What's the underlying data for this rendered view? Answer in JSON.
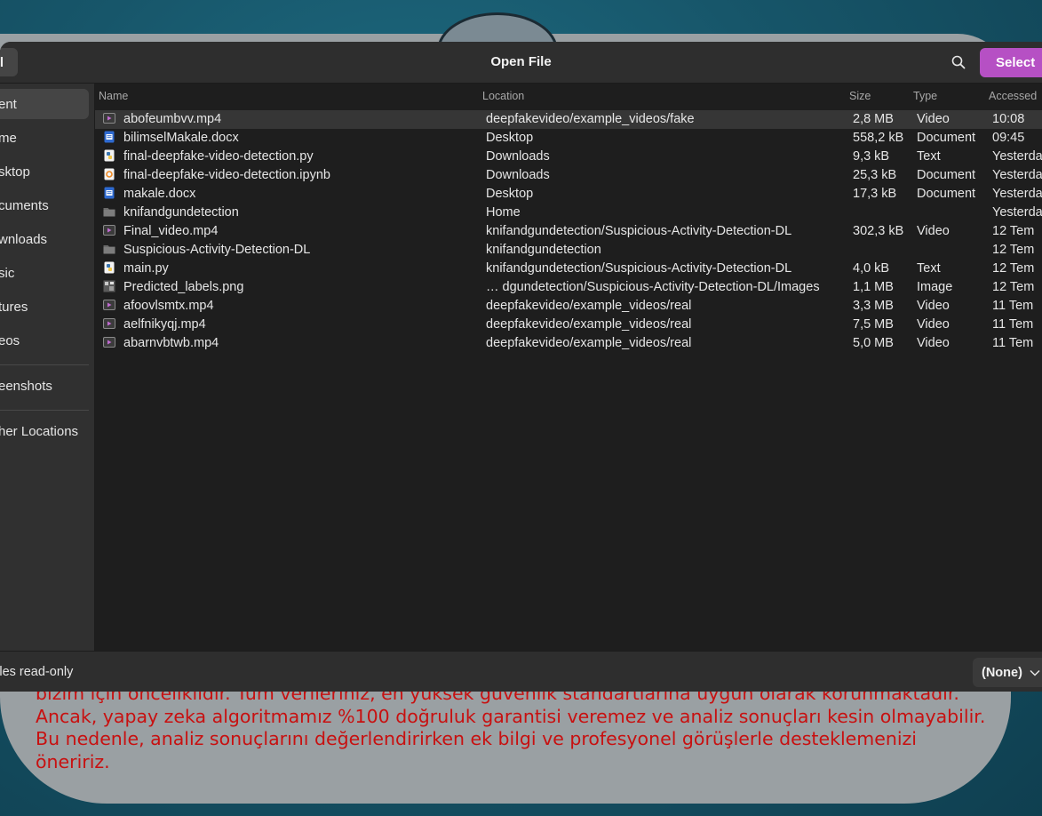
{
  "background_app": {
    "disclaimer_lines": [
      "bizim için önceliklidir. Tüm verileriniz, en yüksek güvenlik standartlarına uygun olarak korunmaktadır.",
      "Ancak, yapay zeka algoritmamız %100 doğruluk garantisi veremez ve analiz sonuçları kesin olmayabilir.",
      "Bu nedenle, analiz sonuçlarını değerlendirirken ek bilgi ve profesyonel görüşlerle desteklemenizi",
      "öneririz."
    ],
    "text_color": "#c81010"
  },
  "dialog": {
    "title": "Open File",
    "cancel_label": "l",
    "select_label": "Select",
    "accent_color": "#b650c4"
  },
  "sidebar": {
    "items": [
      {
        "label": "ent",
        "selected": true
      },
      {
        "label": "me"
      },
      {
        "label": "sktop"
      },
      {
        "label": "cuments"
      },
      {
        "label": "wnloads"
      },
      {
        "label": "sic"
      },
      {
        "label": "tures"
      },
      {
        "label": "eos"
      },
      {
        "label": "eenshots"
      },
      {
        "label": "her Locations"
      }
    ]
  },
  "table": {
    "columns": {
      "name": "Name",
      "location": "Location",
      "size": "Size",
      "type": "Type",
      "accessed": "Accessed"
    },
    "rows": [
      {
        "icon": "video-file-icon",
        "name": "abofeumbvv.mp4",
        "location": "deepfakevideo/example_videos/fake",
        "size": "2,8 MB",
        "type": "Video",
        "accessed": "10:08",
        "selected": true
      },
      {
        "icon": "document-file-icon",
        "name": "bilimselMakale.docx",
        "location": "Desktop",
        "size": "558,2 kB",
        "type": "Document",
        "accessed": "09:45"
      },
      {
        "icon": "python-file-icon",
        "name": "final-deepfake-video-detection.py",
        "location": "Downloads",
        "size": "9,3 kB",
        "type": "Text",
        "accessed": "Yesterday"
      },
      {
        "icon": "notebook-file-icon",
        "name": "final-deepfake-video-detection.ipynb",
        "location": "Downloads",
        "size": "25,3 kB",
        "type": "Document",
        "accessed": "Yesterday"
      },
      {
        "icon": "document-file-icon",
        "name": "makale.docx",
        "location": "Desktop",
        "size": "17,3 kB",
        "type": "Document",
        "accessed": "Yesterday"
      },
      {
        "icon": "folder-icon",
        "name": "knifandgundetection",
        "location": "Home",
        "size": "",
        "type": "",
        "accessed": "Yesterday"
      },
      {
        "icon": "video-file-icon",
        "name": "Final_video.mp4",
        "location": "knifandgundetection/Suspicious-Activity-Detection-DL",
        "size": "302,3 kB",
        "type": "Video",
        "accessed": "12 Tem"
      },
      {
        "icon": "folder-icon",
        "name": "Suspicious-Activity-Detection-DL",
        "location": "knifandgundetection",
        "size": "",
        "type": "",
        "accessed": "12 Tem"
      },
      {
        "icon": "python-file-icon",
        "name": "main.py",
        "location": "knifandgundetection/Suspicious-Activity-Detection-DL",
        "size": "4,0 kB",
        "type": "Text",
        "accessed": "12 Tem"
      },
      {
        "icon": "image-file-icon",
        "name": "Predicted_labels.png",
        "location": "… dgundetection/Suspicious-Activity-Detection-DL/Images",
        "size": "1,1 MB",
        "type": "Image",
        "accessed": "12 Tem"
      },
      {
        "icon": "video-file-icon",
        "name": "afoovlsmtx.mp4",
        "location": "deepfakevideo/example_videos/real",
        "size": "3,3 MB",
        "type": "Video",
        "accessed": "11 Tem"
      },
      {
        "icon": "video-file-icon",
        "name": "aelfnikyqj.mp4",
        "location": "deepfakevideo/example_videos/real",
        "size": "7,5 MB",
        "type": "Video",
        "accessed": "11 Tem"
      },
      {
        "icon": "video-file-icon",
        "name": "abarnvbtwb.mp4",
        "location": "deepfakevideo/example_videos/real",
        "size": "5,0 MB",
        "type": "Video",
        "accessed": "11 Tem"
      }
    ]
  },
  "footer": {
    "readonly_label": "n files read-only",
    "filter_value": "(None)"
  }
}
